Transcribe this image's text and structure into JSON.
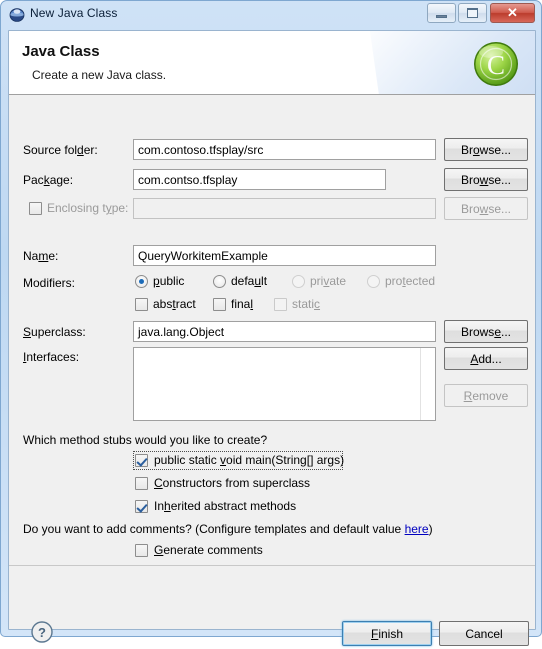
{
  "window": {
    "title": "New Java Class",
    "icon": "java-coffee-planet-icon",
    "minimize_label": "Minimize",
    "maximize_label": "Maximize",
    "close_label": "Close"
  },
  "header": {
    "title": "Java Class",
    "subtitle": "Create a new Java class.",
    "icon": "green-class-badge-icon"
  },
  "form": {
    "source_folder": {
      "label": "Source folder:",
      "value": "com.contoso.tfsplay/src",
      "browse_label": "Browse...",
      "enabled": true
    },
    "package": {
      "label": "Package:",
      "value": "com.contso.tfsplay",
      "browse_label": "Browse...",
      "enabled": true
    },
    "enclosing_type": {
      "label": "Enclosing type:",
      "value": "",
      "checked": false,
      "browse_label": "Browse...",
      "enabled": false
    },
    "name": {
      "label": "Name:",
      "value": "QueryWorkitemExample"
    },
    "modifiers": {
      "label": "Modifiers:",
      "access": [
        {
          "label": "public",
          "checked": true,
          "enabled": true
        },
        {
          "label": "default",
          "checked": false,
          "enabled": true
        },
        {
          "label": "private",
          "checked": false,
          "enabled": false
        },
        {
          "label": "protected",
          "checked": false,
          "enabled": false
        }
      ],
      "flags": [
        {
          "label": "abstract",
          "checked": false,
          "enabled": true
        },
        {
          "label": "final",
          "checked": false,
          "enabled": true
        },
        {
          "label": "static",
          "checked": false,
          "enabled": false
        }
      ]
    },
    "superclass": {
      "label": "Superclass:",
      "value": "java.lang.Object",
      "browse_label": "Browse..."
    },
    "interfaces": {
      "label": "Interfaces:",
      "items": [],
      "add_label": "Add...",
      "remove_label": "Remove",
      "remove_enabled": false
    }
  },
  "stubs": {
    "question": "Which method stubs would you like to create?",
    "options": [
      {
        "label": "public static void main(String[] args)",
        "checked": true,
        "focused": true
      },
      {
        "label": "Constructors from superclass",
        "checked": false,
        "focused": false
      },
      {
        "label": "Inherited abstract methods",
        "checked": true,
        "focused": false
      }
    ]
  },
  "comments": {
    "question_prefix": "Do you want to add comments? (Configure templates and default value ",
    "link": "here",
    "question_suffix": ")",
    "generate": {
      "label": "Generate comments",
      "checked": false
    }
  },
  "footer": {
    "help_icon": "help-question-icon",
    "finish_label": "Finish",
    "cancel_label": "Cancel"
  },
  "colors": {
    "accent": "#3c7fb1",
    "link": "#0000c0",
    "titlebar": "#bed8f2",
    "close_button": "#bb3c2c",
    "disabled_text": "#9a9a9a"
  }
}
